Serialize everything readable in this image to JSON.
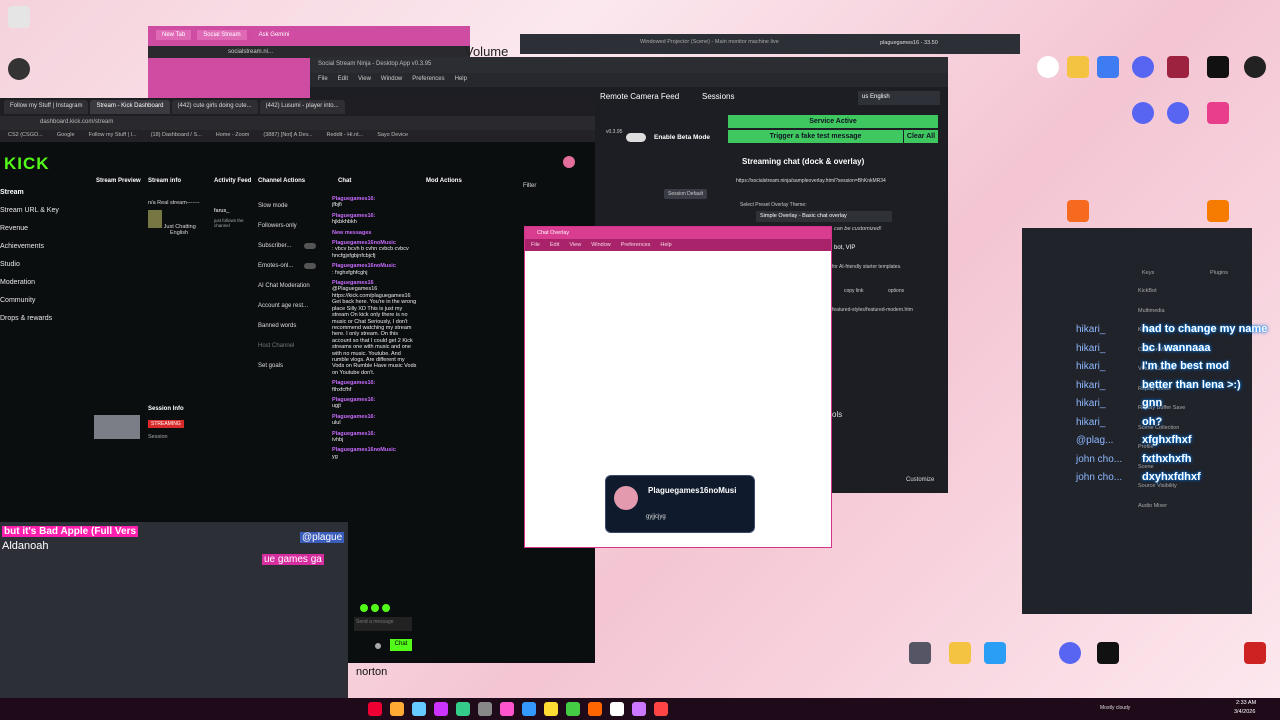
{
  "kick": {
    "tabs": [
      "Follow my Stuff | Instagram",
      "Stream - Kick Dashboard",
      "(442) cute girls doing cute...",
      "(442) Lusumi - player into..."
    ],
    "url": "dashboard.kick.com/stream",
    "bookmarks": [
      "CS2 (CSGO...",
      "Google",
      "Follow my Stuff | I...",
      "(18) Dashboard / S...",
      "Home - Zoom",
      "(3887) [Not] A Dev...",
      "Reddit - Hi.nt...",
      "Sayo Device"
    ],
    "logo": "KICK",
    "sidebar": [
      "Stream",
      "Stream URL & Key",
      "Revenue",
      "Achievements",
      "Studio",
      "Moderation",
      "Community",
      "Drops & rewards"
    ],
    "cols": {
      "stream_preview": "Stream Preview",
      "stream_info": "Stream info",
      "stream_info_title": "n/a Real stream-------",
      "just_chatting": "Just Chatting",
      "english": "English",
      "activity_feed": "Activity Feed",
      "activity_user": "farus_",
      "activity_text": "just follows the channel",
      "channel_actions": "Channel Actions",
      "actions": [
        "Slow mode",
        "Followers-only",
        "Subscriber...",
        "Emotes-onl...",
        "AI Chat Moderation",
        "Account age rest...",
        "Banned words",
        "Host Channel",
        "Set goals"
      ],
      "session_info": "Session Info",
      "streaming": "STREAMING",
      "session": "Session",
      "chat": "Chat",
      "mod_actions": "Mod Actions",
      "filter": "Filter"
    },
    "chat": [
      {
        "user": "Plaguegames16:",
        "text": "jfbjfi"
      },
      {
        "user": "Plaguegames16:",
        "text": "hjkbkhbkh"
      },
      {
        "user": "New messages",
        "text": ""
      },
      {
        "user": "Plaguegames16noMusic",
        "text": ": vbcv bcvh b cvhn cvbcb cvbcv hncfgjxfgbjnfcbjcfj"
      },
      {
        "user": "Plaguegames16noMusic",
        "text": ": fxghxfghfcghj"
      },
      {
        "user": "Plaguegames16",
        "text": "@Plaguegames16 https://kick.com/plaguegames16 Get back here. You're in the wrong place Silly XD This is just my stream On kick only there is no music or Chat Seriously, I don't recommend watching my stream here. I only stream. On this account so that I could get 2 Kick streams one with music and one with no music. Youtube. And rumble vlogs. Are different my Vods on Rumble Have music Vods on Youtube don't."
      },
      {
        "user": "Plaguegames16:",
        "text": "fthxfcfhf"
      },
      {
        "user": "Plaguegames16:",
        "text": "ugjt"
      },
      {
        "user": "Plaguegames16:",
        "text": "ulul"
      },
      {
        "user": "Plaguegames16:",
        "text": "ivhbj"
      },
      {
        "user": "Plaguegames16noMusic",
        "text": "yg"
      }
    ],
    "send_placeholder": "Send a message",
    "chat_button": "Chat"
  },
  "ssn": {
    "title": "Social Stream Ninja - Desktop App v0.3.95",
    "menu": [
      "File",
      "Edit",
      "View",
      "Window",
      "Preferences",
      "Help"
    ],
    "remote": "Remote Camera Feed",
    "sessions": "Sessions",
    "language": "us English",
    "version": "v0.3.95",
    "beta": "Enable Beta Mode",
    "service": "Service Active",
    "trigger": "Trigger a fake test message",
    "clear": "Clear All",
    "streaming_chat": "Streaming chat (dock & overlay)",
    "overlay_url": "https://socialstream.ninja/sampleoverlay.html?session=BhKnkMR34",
    "session_default": "Session Default",
    "theme_label": "Select Preset Overlay Theme:",
    "theme_value": "Simple Overlay - Basic chat overlay",
    "customized": "can be customized!",
    "bot_vip": "bot, VIP",
    "starter": "for AI-friendly starter templates.",
    "featured": "featured-styles/featured-modern.htm",
    "copy_link": "copy link",
    "options": "options",
    "tools": "ols",
    "customize": "Customize"
  },
  "overlay": {
    "title": "Chat Overlay",
    "menu": [
      "File",
      "Edit",
      "View",
      "Window",
      "Preferences",
      "Help"
    ],
    "card_name": "Plaguegames16noMusi",
    "card_msg": "gyjjcjyg"
  },
  "obs": {
    "items": [
      "KickBot",
      "Multimedia",
      "Kicklet",
      "Chapter Marker",
      "Virtual Camera",
      "Replay Buffer",
      "Replay Buffer Save",
      "Scene Collection",
      "Profile",
      "Scene",
      "Source Visibility",
      "Audio Mixer"
    ],
    "keys": "Keys",
    "plugins": "Plugins"
  },
  "overlay_chat": [
    {
      "name": "hikari_",
      "text": "had to change my name",
      "color": "blue"
    },
    {
      "name": "hikari_",
      "text": "bc I wannaaa",
      "color": "blue"
    },
    {
      "name": "hikari_",
      "text": "I'm the best mod",
      "color": "blue"
    },
    {
      "name": "hikari_",
      "text": "better than lena >:)",
      "color": "blue"
    },
    {
      "name": "hikari_",
      "text": "gnn",
      "color": "blue"
    },
    {
      "name": "hikari_",
      "text": "oh?",
      "color": "blue"
    },
    {
      "name": "@plag...",
      "text": "xfghxfhxf",
      "color": "blue"
    },
    {
      "name": "john cho...",
      "text": "fxthxhxfh",
      "color": "blue"
    },
    {
      "name": "john cho...",
      "text": "dxyhxfdhxf",
      "color": "blue"
    }
  ],
  "cam": {
    "bad_apple": "but it's Bad Apple (Full Vers",
    "aldanoah": "Aldanoah",
    "plague_tag": "@plague",
    "plague_sub": "ue games ga"
  },
  "norton": "norton",
  "clock": "2:33 AM",
  "date": "3/4/2026",
  "weather": "Mostly cloudy",
  "browser_top": {
    "tabs": [
      "New Tab",
      "Social Stream",
      "Ask Gemini"
    ],
    "url": "socialstream.ni..."
  },
  "projector": "Windowed Projector (Scene) - Main monitor machine live",
  "plague_title": "plaguegames16 - 33.50",
  "volume": "Volume"
}
